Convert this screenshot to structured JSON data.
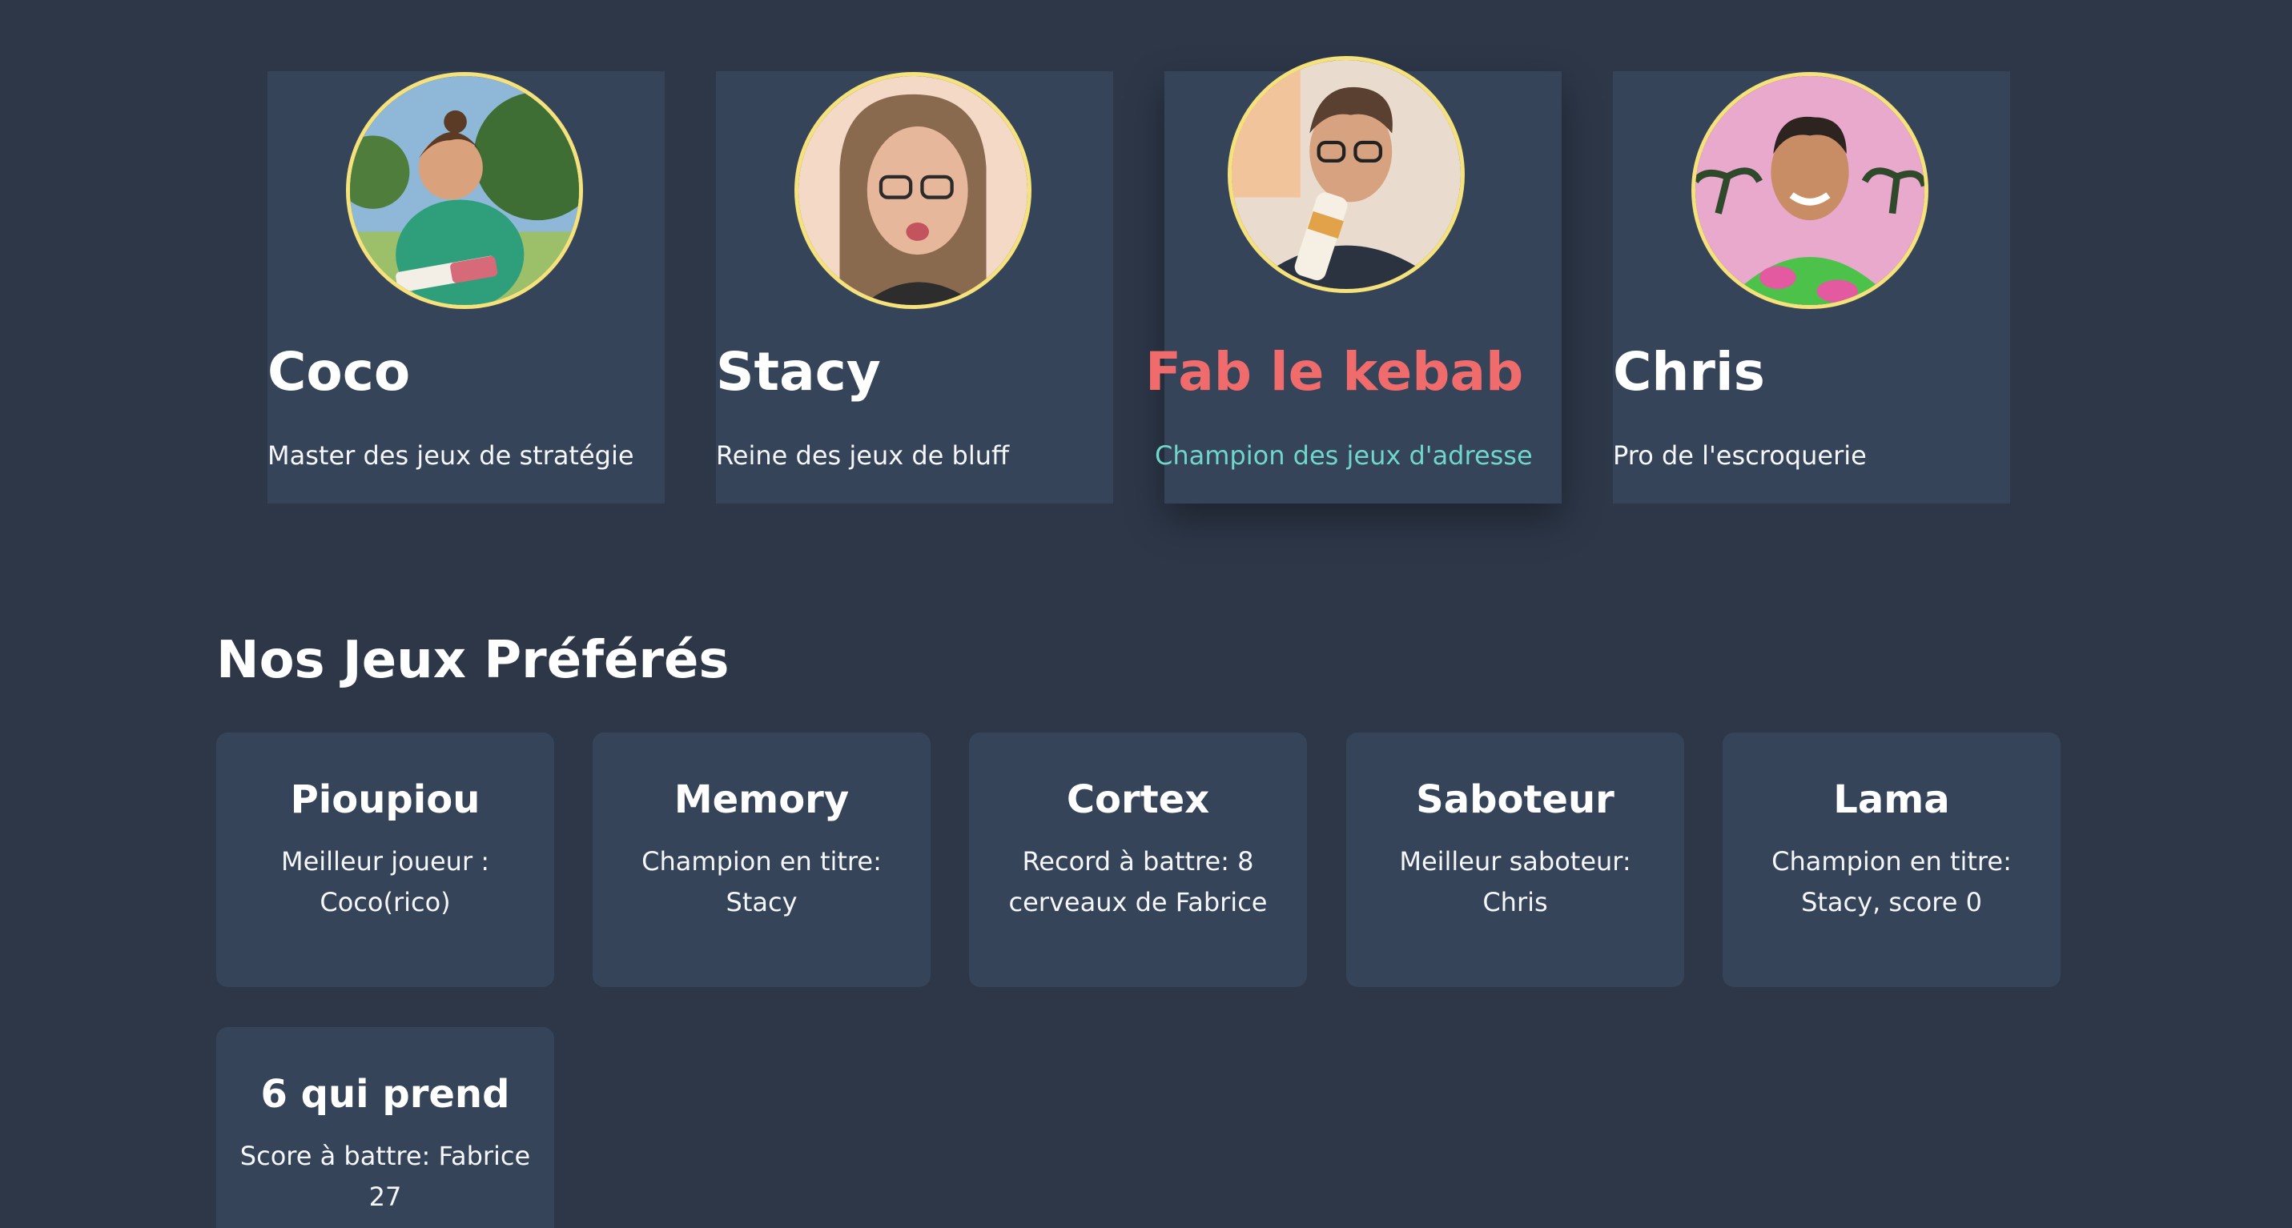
{
  "team": {
    "members": [
      {
        "name": "Coco",
        "title": "Master des jeux de stratégie",
        "avatar_icon": "woman-outdoor-portrait"
      },
      {
        "name": "Stacy",
        "title": "Reine des jeux de bluff",
        "avatar_icon": "woman-glasses-portrait"
      },
      {
        "name": "Fab le kebab",
        "title": "Champion des jeux d'adresse",
        "avatar_icon": "man-glasses-portrait"
      },
      {
        "name": "Chris",
        "title": "Pro de l'escroquerie",
        "avatar_icon": "man-green-hoodie-portrait"
      }
    ]
  },
  "games_section": {
    "title": "Nos Jeux Préférés",
    "games": [
      {
        "name": "Pioupiou",
        "line1": "Meilleur joueur :",
        "line2": "Coco(rico)"
      },
      {
        "name": "Memory",
        "line1": "Champion en titre:",
        "line2": "Stacy"
      },
      {
        "name": "Cortex",
        "line1": "Record à battre: 8",
        "line2": "cerveaux de Fabrice"
      },
      {
        "name": "Saboteur",
        "line1": "Meilleur saboteur:",
        "line2": "Chris"
      },
      {
        "name": "Lama",
        "line1": "Champion en titre:",
        "line2": "Stacy, score 0"
      },
      {
        "name": "6 qui prend",
        "line1": "Score à battre: Fabrice",
        "line2": "27"
      }
    ]
  },
  "colors": {
    "background": "#2d3748",
    "card": "#354459",
    "avatar_border": "#f6e27a",
    "highlight_name": "#f06b6b",
    "highlight_title": "#6fd6c9"
  }
}
